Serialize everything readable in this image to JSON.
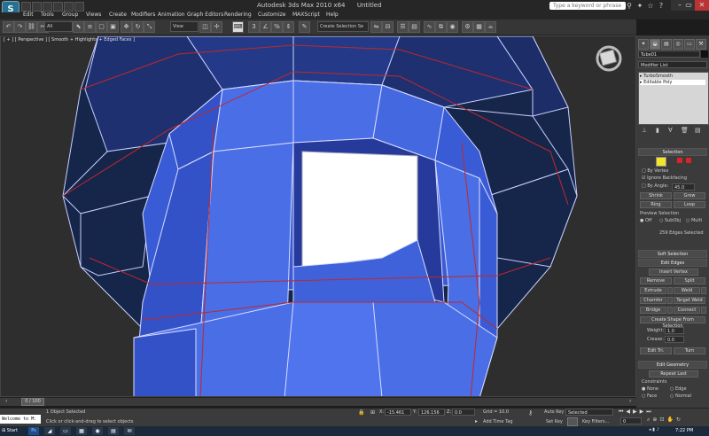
{
  "title": {
    "app": "Autodesk 3ds Max  2010 x64",
    "file": "Untitled"
  },
  "search": {
    "placeholder": "Type a keyword or phrase"
  },
  "menu": [
    "Edit",
    "Tools",
    "Group",
    "Views",
    "Create",
    "Modifiers",
    "Animation",
    "Graph Editors",
    "Rendering",
    "Customize",
    "MAXScript",
    "Help"
  ],
  "toolbar": {
    "filter": "All",
    "coord": "View",
    "selection_set": "Create Selection Se"
  },
  "viewport": {
    "label": "[ + ] [ Perspective ] [ Smooth + Highlights + Edged Faces ]"
  },
  "panel": {
    "object_name": "Tube01",
    "modifier_list": "Modifier List",
    "stack": [
      "TurboSmooth",
      "Editable Poly"
    ],
    "selection": {
      "title": "Selection",
      "by_vertex": "By Vertex",
      "ignore_backfacing": "Ignore Backfacing",
      "by_angle": "By Angle:",
      "by_angle_value": "45.0",
      "shrink": "Shrink",
      "grow": "Grow",
      "ring": "Ring",
      "loop": "Loop",
      "preview": "Preview Selection",
      "preview_opts": [
        "Off",
        "SubObj",
        "Multi"
      ],
      "status": "259 Edges Selected"
    },
    "soft_selection": "Soft Selection",
    "edit_edges": {
      "title": "Edit Edges",
      "insert_vertex": "Insert Vertex",
      "remove": "Remove",
      "split": "Split",
      "extrude": "Extrude",
      "weld": "Weld",
      "chamfer": "Chamfer",
      "target_weld": "Target Weld",
      "bridge": "Bridge",
      "connect": "Connect",
      "create_shape": "Create Shape From Selection",
      "weight_label": "Weight:",
      "weight_value": "1.0",
      "crease_label": "Crease:",
      "crease_value": "0.0",
      "edit_tri": "Edit Tri.",
      "turn": "Turn"
    },
    "edit_geometry": {
      "title": "Edit Geometry",
      "repeat_last": "Repeat Last",
      "constraints": "Constraints",
      "options": [
        "None",
        "Edge",
        "Face",
        "Normal"
      ]
    }
  },
  "timeline": {
    "frame": "0 / 100"
  },
  "status": {
    "maxscript": "Welcome to M:",
    "selected": "1 Object Selected",
    "prompt": "Click or click-and-drag to select objects",
    "x_label": "X:",
    "x_value": "-15.461",
    "y_label": "Y:",
    "y_value": "126.156",
    "z_label": "Z:",
    "z_value": "0.0",
    "grid": "Grid = 10.0",
    "add_time_tag": "Add Time Tag",
    "auto_key": "Auto Key",
    "set_key": "Set Key",
    "key_mode": "Selected",
    "key_filters": "Key Filters...",
    "frame_num": "0"
  },
  "taskbar": {
    "start": "Start",
    "clock": "7:22 PM"
  }
}
